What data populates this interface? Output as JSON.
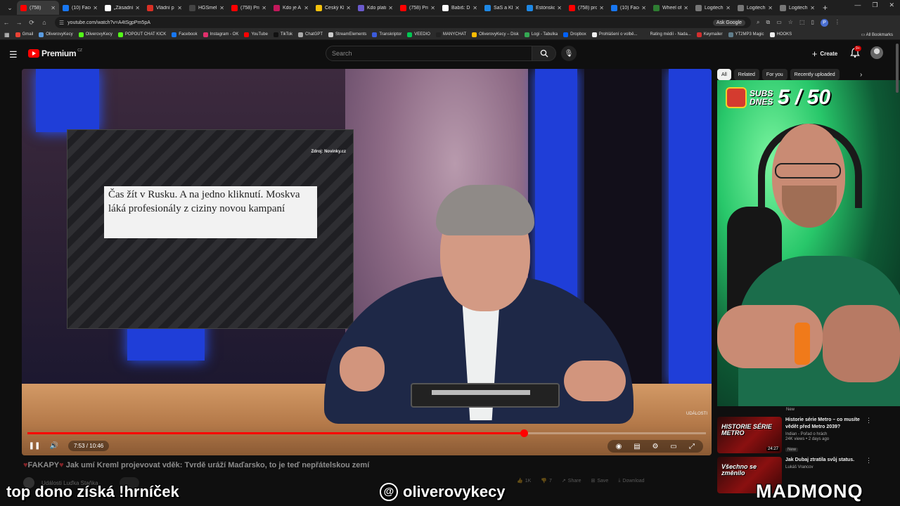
{
  "browser": {
    "tab_menu_icon": "chevron-down-icon",
    "tabs": [
      {
        "label": "(758)",
        "fav": "#ff0000",
        "active": true
      },
      {
        "label": "(10) Face",
        "fav": "#1877f2"
      },
      {
        "label": "„Zásadní",
        "fav": "#ffffff"
      },
      {
        "label": "Vládní p",
        "fav": "#d93025"
      },
      {
        "label": "HGSmeli",
        "fav": "#444444"
      },
      {
        "label": "(758) Pri",
        "fav": "#ff0000"
      },
      {
        "label": "Kdo je A",
        "fav": "#c2185b"
      },
      {
        "label": "Český Kl",
        "fav": "#f4c20d"
      },
      {
        "label": "Kdo plati",
        "fav": "#6a5acd"
      },
      {
        "label": "(758) Pri",
        "fav": "#ff0000"
      },
      {
        "label": "Babiš: Dř",
        "fav": "#ffffff"
      },
      {
        "label": "SaS a KD",
        "fav": "#1e88e5"
      },
      {
        "label": "Estónsko",
        "fav": "#1e88e5"
      },
      {
        "label": "(758) pro",
        "fav": "#ff0000"
      },
      {
        "label": "(10) Face",
        "fav": "#1877f2"
      },
      {
        "label": "Wheel of",
        "fav": "#2e7d32"
      },
      {
        "label": "Logitech",
        "fav": "#777777"
      },
      {
        "label": "Logitech",
        "fav": "#777777"
      },
      {
        "label": "Logitech",
        "fav": "#777777"
      }
    ],
    "url": "youtube.com/watch?v=A4tSgpPm5pA",
    "ask_google": "Ask Google",
    "profile_initial": "P",
    "bookmarks": [
      {
        "label": "Gmail",
        "fav": "#ea4335"
      },
      {
        "label": "OliverovyKecy",
        "fav": "#5a9be0"
      },
      {
        "label": "OliverovyKecy",
        "fav": "#53fc18"
      },
      {
        "label": "POPOUT CHAT KICK",
        "fav": "#53fc18"
      },
      {
        "label": "Facebook",
        "fav": "#1877f2"
      },
      {
        "label": "Instagram - OK",
        "fav": "#e1306c"
      },
      {
        "label": "YouTube",
        "fav": "#ff0000"
      },
      {
        "label": "TikTok",
        "fav": "#111111"
      },
      {
        "label": "ChatGPT",
        "fav": "#aaaaaa"
      },
      {
        "label": "StreamElements",
        "fav": "#cccccc"
      },
      {
        "label": "Transkriptor",
        "fav": "#3b5bdb"
      },
      {
        "label": "VEEDIO",
        "fav": "#00c853"
      },
      {
        "label": "MANYCHAT",
        "fav": "#222222"
      },
      {
        "label": "OliverovyKecy – Disk",
        "fav": "#fbbc04"
      },
      {
        "label": "Logi - Tabulka",
        "fav": "#34a853"
      },
      {
        "label": "Dropbox",
        "fav": "#0061fe"
      },
      {
        "label": "Prohlášení o volbě...",
        "fav": "#eeeeee"
      },
      {
        "label": "Rating médií - Nada...",
        "fav": "#2b2b2b"
      },
      {
        "label": "Keymailer",
        "fav": "#d32f2f"
      },
      {
        "label": "YT2MP3 Magic",
        "fav": "#607d8b"
      },
      {
        "label": "HOOKS",
        "fav": "#eeeeee"
      }
    ],
    "all_bookmarks": "All Bookmarks"
  },
  "youtube": {
    "logo_text": "Premium",
    "logo_country": "CZ",
    "search_placeholder": "Search",
    "create_label": "Create",
    "notif_badge": "9+",
    "video": {
      "panel_source": "Zdroj: Novinky.cz",
      "panel_quote": "Čas žít v Rusku. A na jedno kliknutí. Moskva láká profesionály z ciziny novou kampaní",
      "watermark": "UDÁLOSTI",
      "time": "7:53 / 10:46",
      "progress": 0.732,
      "title_prefix": "FAKAPY",
      "title": "Jak umí Kreml projevovat vděk: Tvrdě uráží Maďarsko, to je teď nepřátelskou zemí",
      "channel": "Události Luďka Staňka",
      "actions": [
        {
          "icon": "thumbs-up-icon",
          "label": "1K"
        },
        {
          "icon": "thumbs-down-icon",
          "label": "7"
        },
        {
          "icon": "share-icon",
          "label": "Share"
        },
        {
          "icon": "save-icon",
          "label": "Save"
        },
        {
          "icon": "download-icon",
          "label": "Download"
        }
      ]
    },
    "chips": [
      "All",
      "Related",
      "For you",
      "Recently uploaded"
    ],
    "webcam": {
      "subs_label": "SUBS DNES",
      "subs_count": "5 / 50"
    },
    "recs": [
      {
        "thumb_label": "HISTORIE SÉRIE METRO",
        "duration": "24:27",
        "title": "Historie série Metro – co musíte vědět před Metro 2039?",
        "channel": "Indian - Pořad o hrách",
        "views": "24K views • 2 days ago",
        "badge": "New"
      },
      {
        "thumb_label": "Všechno se změnilo",
        "duration": "",
        "title": "Jak Dubaj ztratila svůj status.",
        "channel": "Lukáš Vrancov",
        "views": "",
        "badge": ""
      }
    ],
    "rec_top_badge": "New"
  },
  "stream_overlay": {
    "left_text": "top dono získá !hrníček",
    "handle": "oliverovykecy",
    "brand": "MADMONQ"
  },
  "colors": {
    "yt_red": "#ff0000",
    "bg": "#0f0f0f",
    "webcam_green": "#28c76a"
  }
}
